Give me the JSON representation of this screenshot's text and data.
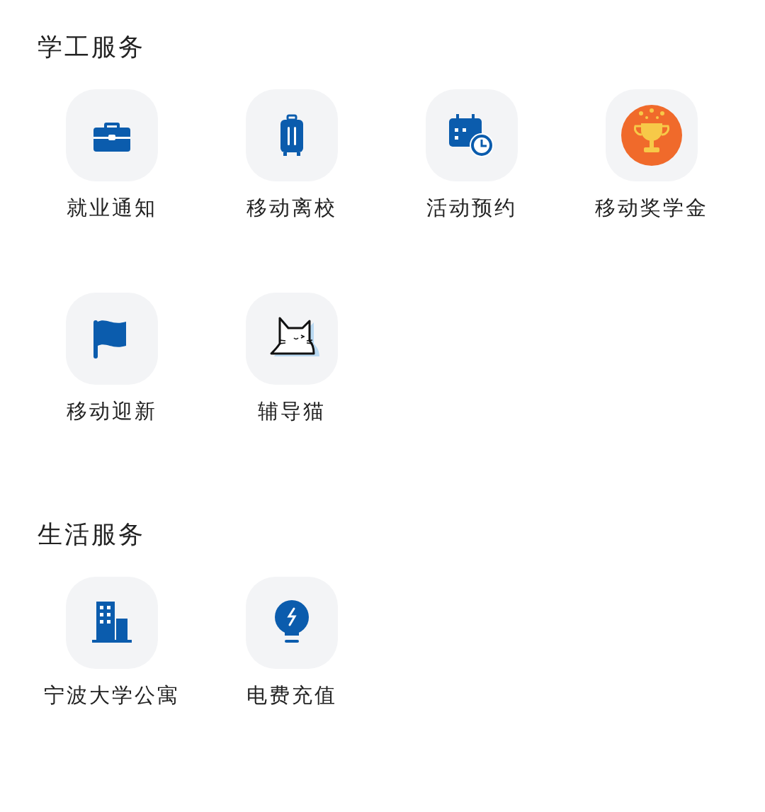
{
  "sections": [
    {
      "title": "学工服务",
      "items": [
        {
          "label": "就业通知",
          "kind": "briefcase"
        },
        {
          "label": "移动离校",
          "kind": "suitcase"
        },
        {
          "label": "活动预约",
          "kind": "calendar"
        },
        {
          "label": "移动奖学金",
          "kind": "trophy"
        },
        {
          "label": "移动迎新",
          "kind": "flag"
        },
        {
          "label": "辅导猫",
          "kind": "cat"
        }
      ]
    },
    {
      "title": "生活服务",
      "items": [
        {
          "label": "宁波大学公寓",
          "kind": "building"
        },
        {
          "label": "电费充值",
          "kind": "bulb"
        }
      ]
    }
  ]
}
